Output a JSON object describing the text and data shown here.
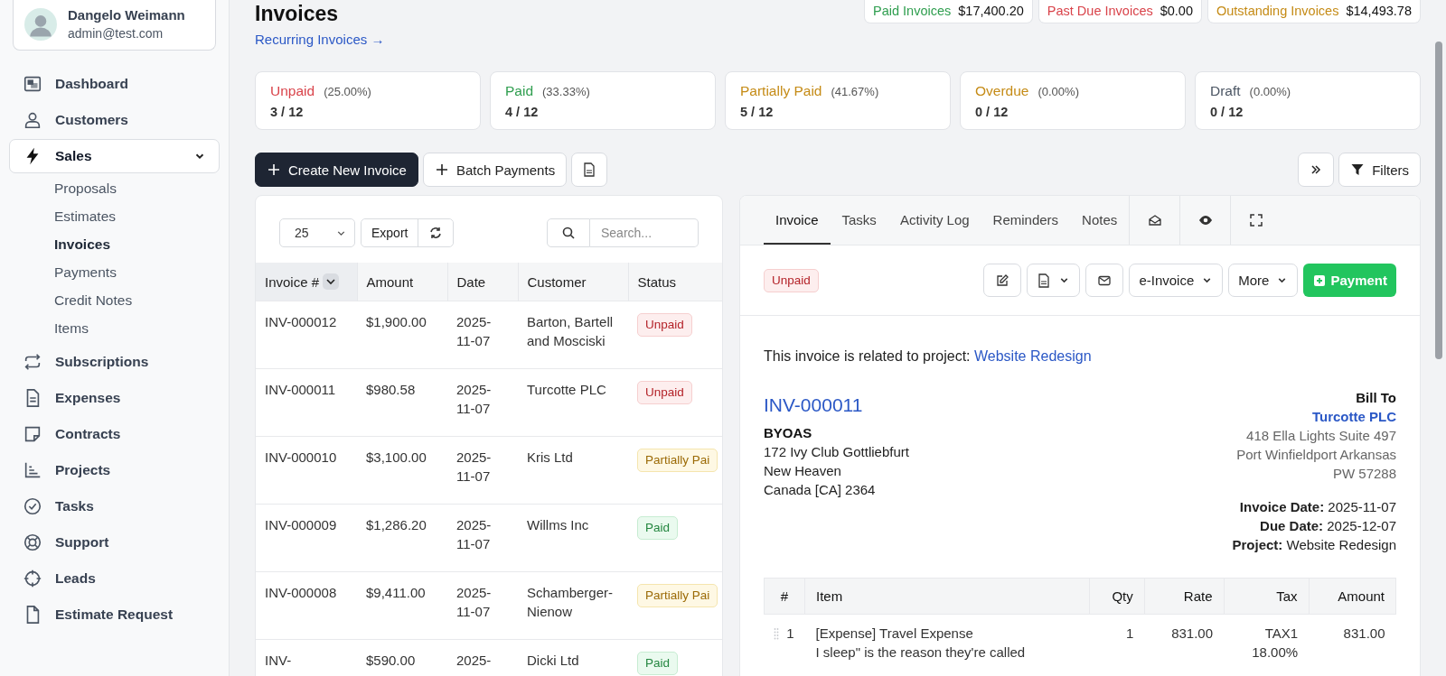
{
  "sidebar": {
    "user": {
      "name": "Dangelo Weimann",
      "email": "admin@test.com"
    },
    "items": [
      {
        "label": "Dashboard",
        "selected": false
      },
      {
        "label": "Customers",
        "selected": false
      },
      {
        "label": "Sales",
        "selected": true,
        "expanded": true,
        "children": [
          {
            "label": "Proposals",
            "selected": false
          },
          {
            "label": "Estimates",
            "selected": false
          },
          {
            "label": "Invoices",
            "selected": true
          },
          {
            "label": "Payments",
            "selected": false
          },
          {
            "label": "Credit Notes",
            "selected": false
          },
          {
            "label": "Items",
            "selected": false
          }
        ]
      },
      {
        "label": "Subscriptions",
        "selected": false
      },
      {
        "label": "Expenses",
        "selected": false
      },
      {
        "label": "Contracts",
        "selected": false
      },
      {
        "label": "Projects",
        "selected": false
      },
      {
        "label": "Tasks",
        "selected": false
      },
      {
        "label": "Support",
        "selected": false
      },
      {
        "label": "Leads",
        "selected": false
      },
      {
        "label": "Estimate Request",
        "selected": false
      }
    ]
  },
  "header": {
    "title": "Invoices",
    "link": "Recurring Invoices →"
  },
  "totals": [
    {
      "label": "Paid Invoices",
      "value": "$17,400.20",
      "color": "#2f9e4f"
    },
    {
      "label": "Past Due Invoices",
      "value": "$0.00",
      "color": "#d9434a"
    },
    {
      "label": "Outstanding Invoices",
      "value": "$14,493.78",
      "color": "#c58b16"
    }
  ],
  "stats": [
    {
      "label": "Unpaid",
      "percent": "(25.00%)",
      "count": "3 / 12",
      "color": "#d9434a"
    },
    {
      "label": "Paid",
      "percent": "(33.33%)",
      "count": "4 / 12",
      "color": "#2f9e4f"
    },
    {
      "label": "Partially Paid",
      "percent": "(41.67%)",
      "count": "5 / 12",
      "color": "#c58b16"
    },
    {
      "label": "Overdue",
      "percent": "(0.00%)",
      "count": "0 / 12",
      "color": "#c58b16"
    },
    {
      "label": "Draft",
      "percent": "(0.00%)",
      "count": "0 / 12",
      "color": "#4b5563"
    }
  ],
  "toolbar": {
    "create": "Create New Invoice",
    "batch": "Batch Payments",
    "filters": "Filters"
  },
  "table": {
    "per_page": "25",
    "export": "Export",
    "search_placeholder": "Search...",
    "columns": [
      {
        "label": "Invoice #",
        "sorted": true
      },
      {
        "label": "Amount",
        "sorted": false
      },
      {
        "label": "Date",
        "sorted": false
      },
      {
        "label": "Customer",
        "sorted": false
      },
      {
        "label": "Status",
        "sorted": false
      }
    ],
    "rows": [
      {
        "number": "INV-000012",
        "amount": "$1,900.00",
        "date": "2025-11-07",
        "customer": "Barton, Bartell and Mosciski",
        "status": {
          "label": "Unpaid",
          "kind": "unpaid"
        }
      },
      {
        "number": "INV-000011",
        "amount": "$980.58",
        "date": "2025-11-07",
        "customer": "Turcotte PLC",
        "status": {
          "label": "Unpaid",
          "kind": "unpaid"
        }
      },
      {
        "number": "INV-000010",
        "amount": "$3,100.00",
        "date": "2025-11-07",
        "customer": "Kris Ltd",
        "status": {
          "label": "Partially Pai",
          "kind": "partial"
        }
      },
      {
        "number": "INV-000009",
        "amount": "$1,286.20",
        "date": "2025-11-07",
        "customer": "Willms Inc",
        "status": {
          "label": "Paid",
          "kind": "paid"
        }
      },
      {
        "number": "INV-000008",
        "amount": "$9,411.00",
        "date": "2025-11-07",
        "customer": "Schamberger-Nienow",
        "status": {
          "label": "Partially Pai",
          "kind": "partial"
        }
      },
      {
        "number": "INV-",
        "amount": "$590.00",
        "date": "2025-",
        "customer": "Dicki Ltd",
        "status": {
          "label": "Paid",
          "kind": "paid"
        }
      }
    ]
  },
  "detail": {
    "tabs": [
      {
        "label": "Invoice",
        "selected": true
      },
      {
        "label": "Tasks",
        "selected": false
      },
      {
        "label": "Activity Log",
        "selected": false
      },
      {
        "label": "Reminders",
        "selected": false
      },
      {
        "label": "Notes",
        "selected": false
      }
    ],
    "status": {
      "label": "Unpaid",
      "kind": "unpaid"
    },
    "actions": {
      "e_invoice": "e-Invoice",
      "more": "More",
      "payment": "Payment"
    },
    "project_note": "This invoice is related to project:",
    "project_link": "Website Redesign",
    "number": "INV-000011",
    "company": {
      "name": "BYOAS",
      "lines": [
        "172 Ivy Club Gottliebfurt",
        "New Heaven",
        "Canada [CA] 2364"
      ]
    },
    "bill_to": {
      "heading": "Bill To",
      "customer": "Turcotte PLC",
      "lines": [
        "418 Ella Lights Suite 497",
        "Port Winfieldport Arkansas",
        "PW 57288"
      ]
    },
    "dates": [
      {
        "label": "Invoice Date:",
        "value": "2025-11-07"
      },
      {
        "label": "Due Date:",
        "value": "2025-12-07"
      },
      {
        "label": "Project:",
        "value": "Website Redesign"
      }
    ],
    "items": {
      "columns": [
        "#",
        "Item",
        "Qty",
        "Rate",
        "Tax",
        "Amount"
      ],
      "rows": [
        {
          "index": "1",
          "item": "[Expense] Travel Expense",
          "description": "I sleep\" is the reason they're called",
          "qty": "1",
          "rate": "831.00",
          "tax": "TAX1",
          "tax_rate": "18.00%",
          "amount": "831.00"
        }
      ]
    }
  }
}
